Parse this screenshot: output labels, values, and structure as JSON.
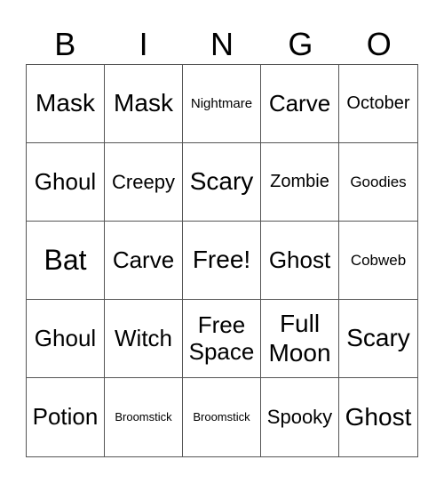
{
  "header": [
    "B",
    "I",
    "N",
    "G",
    "O"
  ],
  "cells": [
    "Mask",
    "Mask",
    "Nightmare",
    "Carve",
    "October",
    "Ghoul",
    "Creepy",
    "Scary",
    "Zombie",
    "Goodies",
    "Bat",
    "Carve",
    "Free!",
    "Ghost",
    "Cobweb",
    "Ghoul",
    "Witch",
    "Free Space",
    "Full Moon",
    "Scary",
    "Potion",
    "Broomstick",
    "Broomstick",
    "Spooky",
    "Ghost"
  ]
}
